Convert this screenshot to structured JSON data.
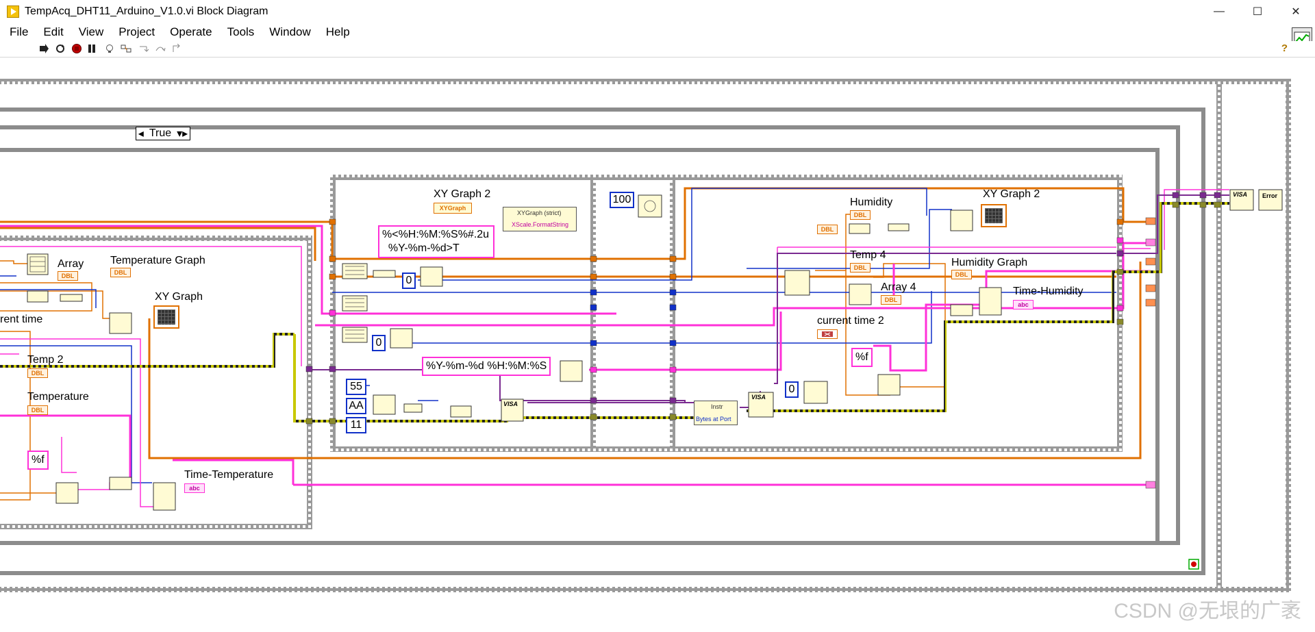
{
  "window": {
    "title": "TempAcq_DHT11_Arduino_V1.0.vi Block Diagram",
    "minimize": "—",
    "maximize": "☐",
    "close": "✕"
  },
  "menu": [
    "File",
    "Edit",
    "View",
    "Project",
    "Operate",
    "Tools",
    "Window",
    "Help"
  ],
  "toolbar": {
    "help": "?"
  },
  "diagram": {
    "case_selector": "True",
    "labels": {
      "xy_graph_2_left": "XY Graph 2",
      "xy_graph_2_right": "XY Graph 2",
      "array": "Array",
      "temperature_graph": "Temperature Graph",
      "xy_graph": "XY Graph",
      "current_time": "rent time",
      "temp2": "Temp 2",
      "temperature": "Temperature",
      "time_temperature": "Time-Temperature",
      "humidity": "Humidity",
      "temp4": "Temp 4",
      "humidity_graph": "Humidity Graph",
      "array4": "Array 4",
      "time_humidity": "Time-Humidity",
      "current_time_2": "current time 2"
    },
    "constants": {
      "c100": "100",
      "c0_a": "0",
      "c0_b": "0",
      "c0_c": "0",
      "c55": "55",
      "cAA": "AA",
      "c11": "11"
    },
    "strings": {
      "format_time": "%<%H:%M:%S%#.2u\n  %Y-%m-%d>T",
      "format_datetime": "%Y-%m-%d %H:%M:%S",
      "pct_f_left": "%f",
      "pct_f_right": "%f"
    },
    "nodes": {
      "xygraph_ref": "XYGraph",
      "xygraph_strict": "XYGraph (strict)",
      "xscale_format": "XScale.FormatString",
      "instr": "Instr",
      "bytes_at_port": "Bytes at Port",
      "visa": "VISA",
      "error": "Error"
    },
    "indicator_types": {
      "dbl": "DBL",
      "abc": "abc"
    }
  },
  "watermark": "CSDN @无垠的广袤"
}
